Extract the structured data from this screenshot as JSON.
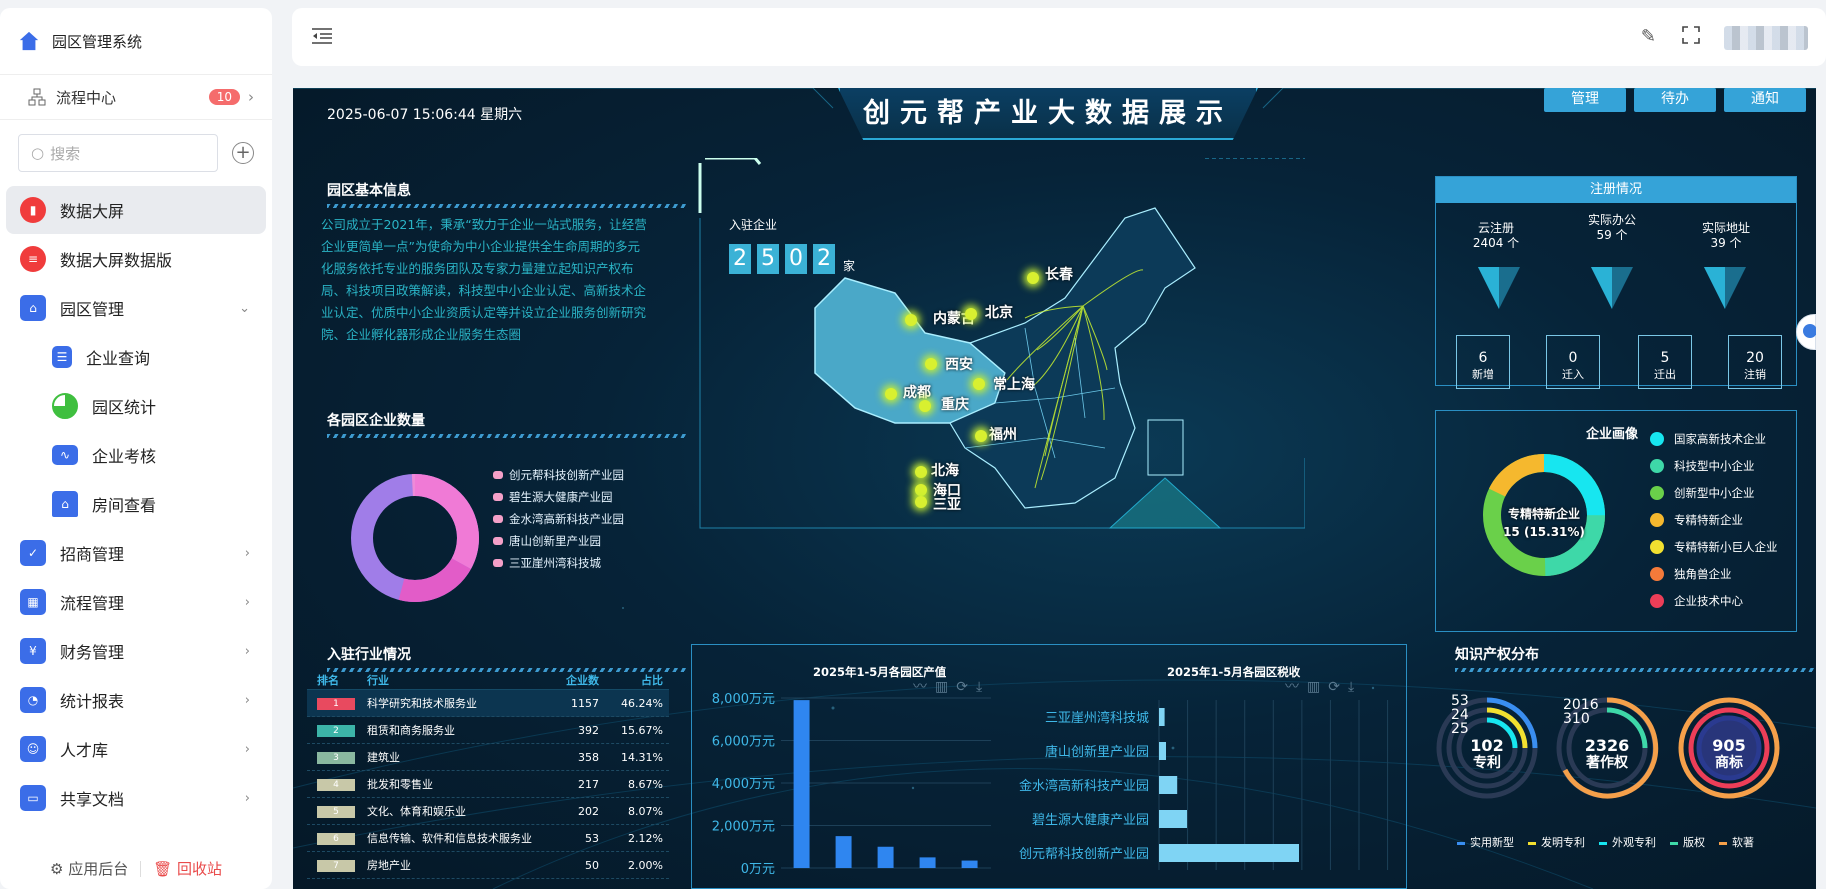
{
  "app": {
    "title": "园区管理系统"
  },
  "sidebar": {
    "flow": {
      "label": "流程中心",
      "badge": "10"
    },
    "search_placeholder": "搜索",
    "items": [
      {
        "label": "数据大屏"
      },
      {
        "label": "数据大屏数据版"
      },
      {
        "label": "园区管理"
      },
      {
        "label": "企业查询"
      },
      {
        "label": "园区统计"
      },
      {
        "label": "企业考核"
      },
      {
        "label": "房间查看"
      },
      {
        "label": "招商管理"
      },
      {
        "label": "流程管理"
      },
      {
        "label": "财务管理"
      },
      {
        "label": "统计报表"
      },
      {
        "label": "人才库"
      },
      {
        "label": "共享文档"
      }
    ],
    "footer": {
      "admin": "应用后台",
      "recycle": "回收站"
    }
  },
  "screen": {
    "datetime": "2025-06-07  15:06:44  星期六",
    "title": "创元帮产业大数据展示",
    "buttons": [
      "管理",
      "待办",
      "通知"
    ],
    "park_info": {
      "title": "园区基本信息",
      "text": "公司成立于2021年，秉承“致力于企业一站式服务，让经营企业更简单一点”为使命为中小企业提供全生命周期的多元化服务依托专业的服务团队及专家力量建立起知识产权布局、科技项目政策解读，科技型中小企业认定、高新技术企业认定、优质中小企业资质认定等并设立企业服务创新研究院、企业孵化器形成企业服务生态圈"
    },
    "park_count": {
      "title": "各园区企业数量",
      "legend": [
        "创元帮科技创新产业园",
        "碧生源大健康产业园",
        "金水湾高新科技产业园",
        "唐山创新里产业园",
        "三亚崖州湾科技城"
      ],
      "colors": [
        "#a07de8",
        "#f07ad6",
        "#e25cc8",
        "#ee8ad8",
        "#f4a0c8"
      ]
    },
    "industry": {
      "title": "入驻行业情况",
      "headers": [
        "排名",
        "行业",
        "企业数",
        "占比"
      ],
      "rows": [
        {
          "rank": "1",
          "name": "科学研究和技术服务业",
          "count": "1157",
          "pct": "46.24%",
          "color": "#e84a5f"
        },
        {
          "rank": "2",
          "name": "租赁和商务服务业",
          "count": "392",
          "pct": "15.67%",
          "color": "#3cb4a8"
        },
        {
          "rank": "3",
          "name": "建筑业",
          "count": "358",
          "pct": "14.31%",
          "color": "#8ab8a0"
        },
        {
          "rank": "4",
          "name": "批发和零售业",
          "count": "217",
          "pct": "8.67%",
          "color": "#c8c8a8"
        },
        {
          "rank": "5",
          "name": "文化、体育和娱乐业",
          "count": "202",
          "pct": "8.07%",
          "color": "#c8c8a8"
        },
        {
          "rank": "6",
          "name": "信息传输、软件和信息技术服务业",
          "count": "53",
          "pct": "2.12%",
          "color": "#c8c8a8"
        },
        {
          "rank": "7",
          "name": "房地产业",
          "count": "50",
          "pct": "2.00%",
          "color": "#c8c8a8"
        }
      ]
    },
    "map": {
      "counter_label": "入驻企业",
      "digits": [
        "2",
        "5",
        "0",
        "2"
      ],
      "unit": "家",
      "cities": [
        "长春",
        "内蒙古",
        "北京",
        "西安",
        "成都",
        "重庆",
        "常上海",
        "福州",
        "北海",
        "海口",
        "三亚"
      ]
    },
    "registration": {
      "title": "注册情况",
      "stats": [
        {
          "label": "云注册",
          "value": "2404 个"
        },
        {
          "label": "实际办公",
          "value": "59 个"
        },
        {
          "label": "实际地址",
          "value": "39 个"
        }
      ],
      "boxes": [
        {
          "value": "6",
          "label": "新增"
        },
        {
          "value": "0",
          "label": "迁入"
        },
        {
          "value": "5",
          "label": "迁出"
        },
        {
          "value": "20",
          "label": "注销"
        }
      ]
    },
    "profile": {
      "title": "企业画像",
      "center_label": "专精特新企业",
      "center_value": "15 (15.31%)",
      "legend": [
        {
          "label": "国家高新技术企业",
          "color": "#17e6f0"
        },
        {
          "label": "科技型中小企业",
          "color": "#3ed8a8"
        },
        {
          "label": "创新型中小企业",
          "color": "#6ad04a"
        },
        {
          "label": "专精特新企业",
          "color": "#f5b82e"
        },
        {
          "label": "专精特新小巨人企业",
          "color": "#f2e030"
        },
        {
          "label": "独角兽企业",
          "color": "#f47a3a"
        },
        {
          "label": "企业技术中心",
          "color": "#ec3e58"
        }
      ]
    },
    "ip": {
      "title": "知识产权分布",
      "patent": {
        "a": "53",
        "b": "24",
        "c": "25",
        "total": "102",
        "label": "专利"
      },
      "copyright": {
        "a": "2016",
        "b": "310",
        "total": "2326",
        "label": "著作权"
      },
      "trademark": {
        "total": "905",
        "label": "商标"
      },
      "legend": [
        {
          "label": "实用新型",
          "color": "#3a8ef0"
        },
        {
          "label": "发明专利",
          "color": "#f2e030"
        },
        {
          "label": "外观专利",
          "color": "#17e6f0"
        },
        {
          "label": "版权",
          "color": "#3ed8a8"
        },
        {
          "label": "软著",
          "color": "#f5a04a"
        }
      ]
    }
  },
  "chart_data": [
    {
      "type": "bar",
      "title": "2025年1-5月各园区产值",
      "categories": [
        "创元帮科技创新产业园",
        "碧生源大健康产业园",
        "金水湾高新科技产业园",
        "唐山创新里产业园",
        "三亚崖州湾科技城"
      ],
      "values": [
        7900,
        1500,
        1000,
        500,
        350
      ],
      "yticks": [
        "0万元",
        "2,000万元",
        "4,000万元",
        "6,000万元",
        "8,000万元"
      ],
      "ylim": [
        0,
        8000
      ],
      "color": "#2f86f0"
    },
    {
      "type": "bar",
      "orientation": "horizontal",
      "title": "2025年1-5月各园区税收",
      "categories": [
        "创元帮科技创新产业园",
        "碧生源大健康产业园",
        "金水湾高新科技产业园",
        "唐山创新里产业园",
        "三亚崖州湾科技城"
      ],
      "values": [
        100,
        20,
        13,
        5,
        4
      ],
      "color": "#7fd4f4"
    }
  ]
}
